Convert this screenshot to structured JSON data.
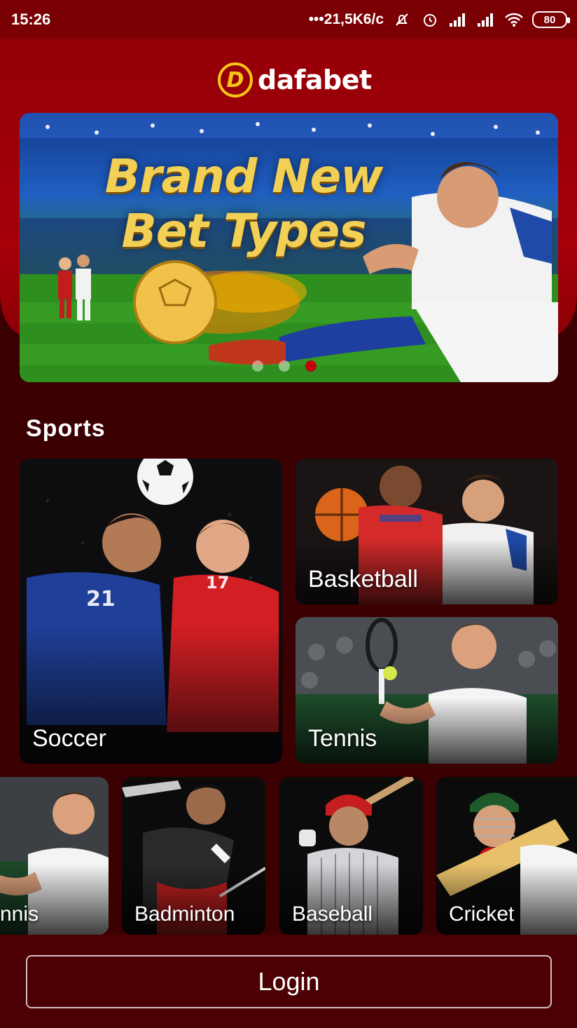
{
  "status_bar": {
    "time": "15:26",
    "network_speed": "21,5K6/c",
    "battery": "80",
    "icons": [
      "mute-icon",
      "alarm-icon",
      "signal-icon",
      "signal-icon",
      "wifi-icon",
      "battery-icon"
    ]
  },
  "brand": {
    "name": "dafabet",
    "logo_letter": "D",
    "color": "#f5c518"
  },
  "banner": {
    "title_line1": "Brand New",
    "title_line2": "Bet Types",
    "slides": 3,
    "active_slide": 3
  },
  "sports": {
    "title": "Sports",
    "main_cards": [
      {
        "label": "Soccer"
      },
      {
        "label": "Basketball"
      },
      {
        "label": "Tennis"
      }
    ],
    "carousel": [
      {
        "label": "nnis"
      },
      {
        "label": "Badminton"
      },
      {
        "label": "Baseball"
      },
      {
        "label": "Cricket"
      }
    ]
  },
  "login": {
    "label": "Login"
  },
  "colors": {
    "primary_red": "#a60009",
    "dark_red": "#3a0002",
    "accent": "#c40010"
  }
}
